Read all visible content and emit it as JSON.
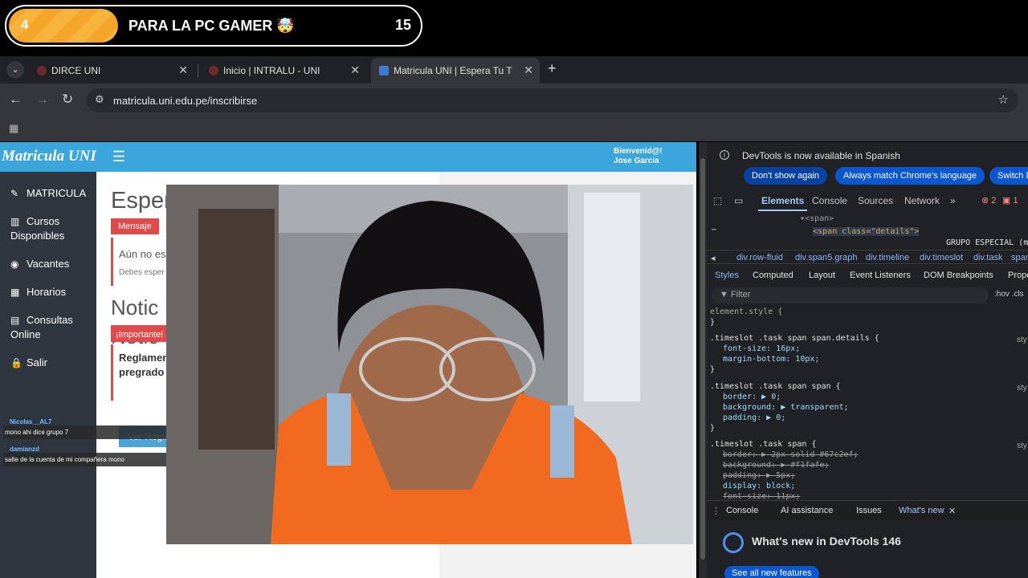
{
  "overlay": {
    "number": "4",
    "title": "PARA LA PC GAMER 🤯",
    "count": "15"
  },
  "tabs": [
    {
      "label": "DIRCE UNI",
      "color": "#6b2b2b"
    },
    {
      "label": "Inicio | INTRALU - UNI",
      "color": "#6b2b2b"
    },
    {
      "label": "Matricula UNI | Espera Tu Turno",
      "color": "#3a7bd5"
    }
  ],
  "address": {
    "url": "matricula.uni.edu.pe/inscribirse"
  },
  "site": {
    "logo": "Matricula UNI",
    "welcome_line1": "Bienvenid@!",
    "welcome_line2": "Jose Garcia",
    "sidebar": [
      {
        "icon": "✎",
        "label": "MATRICULA"
      },
      {
        "icon": "▥",
        "label": "Cursos Disponibles"
      },
      {
        "icon": "◉",
        "label": "Vacantes"
      },
      {
        "icon": "▦",
        "label": "Horarios"
      },
      {
        "icon": "▤",
        "label": "Consultas Online"
      },
      {
        "icon": "🔒",
        "label": "Salir"
      }
    ],
    "heading_espera": "Espera",
    "label_mensaje": "Mensaje",
    "msg1": "Aún no es",
    "msg2": "Debes esper",
    "heading_noticias": "Notic",
    "label_importante": "¡Importante!",
    "regl1": "Reglamen",
    "regl2": "pregrado",
    "btn_ver": "Ver Regla"
  },
  "chat": [
    {
      "user": "Nicolas__AL7",
      "message": "mono ahi dice grupo 7"
    },
    {
      "user": "damianzd",
      "message": "salte de la cuenta de mi compañera mono"
    }
  ],
  "devtools": {
    "banner": "DevTools is now available in Spanish",
    "btn_dont": "Don't show again",
    "btn_match": "Always match Chrome's language",
    "btn_switch": "Switch DevTools to Spanish",
    "tabs": [
      "Elements",
      "Console",
      "Sources",
      "Network"
    ],
    "more": "»",
    "errors": "2",
    "issues": "1",
    "code1": "▾<span>",
    "code2": "<span class=\"details\">",
    "code3": "GRUPO ESPECIAL (m",
    "breadcrumbs": [
      "div.row-fluid",
      "div.span5.graph",
      "div.timeline",
      "div.timeslot",
      "div.task",
      "span"
    ],
    "subtabs": [
      "Styles",
      "Computed",
      "Layout",
      "Event Listeners",
      "DOM Breakpoints",
      "Properties"
    ],
    "filter": "Filter",
    "hov": ":hov .cls",
    "rule0": "element.style {",
    "rule1_sel": ".timeslot .task span span.details {",
    "rule1_p1": "font-size: 16px;",
    "rule1_p2": "margin-bottom: 10px;",
    "rule2_sel": ".timeslot .task span span {",
    "rule2_p1": "border: ▶ 0;",
    "rule2_p2": "background: ▶ transparent;",
    "rule2_p3": "padding: ▶ 0;",
    "rule3_sel": ".timeslot .task span {",
    "rule3_p1": "border: ▶ 2px solid #67c2ef;",
    "rule3_p2": "background: ▶ #f1fafe;",
    "rule3_p3": "padding: ▶ 5px;",
    "rule3_p4": "display: block;",
    "rule3_p5": "font-size: 11px;",
    "close": "}",
    "sty": "sty",
    "drawer": [
      "Console",
      "AI assistance",
      "Issues",
      "What's new"
    ],
    "whatsnew": "What's new in DevTools 146",
    "see_all": "See all new features"
  }
}
